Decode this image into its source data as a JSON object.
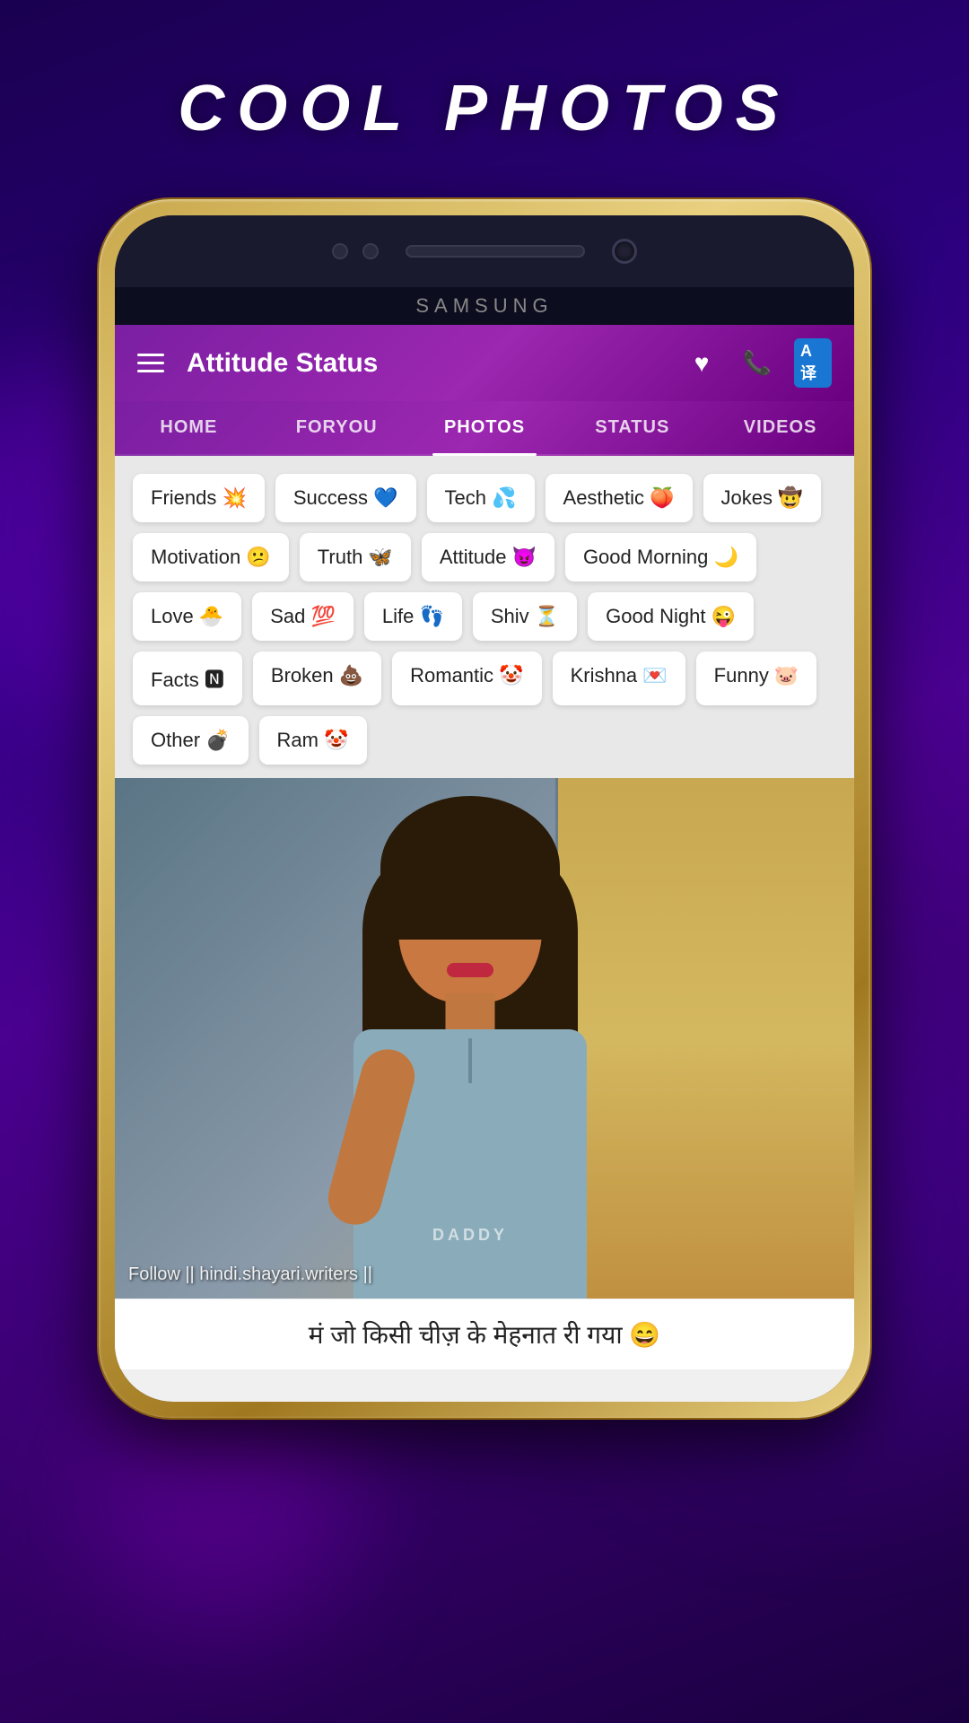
{
  "page": {
    "title": "COOL PHOTOS",
    "background_color": "#2d0080"
  },
  "app": {
    "title": "Attitude Status",
    "header_icons": {
      "heart": "♥",
      "phone": "📞",
      "translate": "A译"
    }
  },
  "nav_tabs": [
    {
      "label": "HOME",
      "active": false
    },
    {
      "label": "FORYOU",
      "active": false
    },
    {
      "label": "PHOTOS",
      "active": true
    },
    {
      "label": "STATUS",
      "active": false
    },
    {
      "label": "VIDEOS",
      "active": false
    }
  ],
  "categories": [
    {
      "label": "Friends 💥"
    },
    {
      "label": "Success 💙"
    },
    {
      "label": "Tech 💦"
    },
    {
      "label": "Aesthetic 🍑"
    },
    {
      "label": "Jokes 🤠"
    },
    {
      "label": "Motivation 😕"
    },
    {
      "label": "Truth 🦋"
    },
    {
      "label": "Attitude 😈"
    },
    {
      "label": "Good Morning 🌙"
    },
    {
      "label": "Love 🐣"
    },
    {
      "label": "Sad 💯"
    },
    {
      "label": "Life 👣"
    },
    {
      "label": "Shiv ⏳"
    },
    {
      "label": "Good Night 😜"
    },
    {
      "label": "Facts 🅽"
    },
    {
      "label": "Broken 💩"
    },
    {
      "label": "Romantic 🤡"
    },
    {
      "label": "Krishna 💌"
    },
    {
      "label": "Funny 🐷"
    },
    {
      "label": "Other 💣"
    },
    {
      "label": "Ram 🤡"
    }
  ],
  "photo": {
    "overlay_text": "Follow || hindi.shayari.writers ||",
    "shirt_text": "DADDY",
    "hindi_text": "मं जो किसी चीज़ के मेहनात री गया 😄"
  },
  "samsung": {
    "brand": "SAMSUNG"
  }
}
